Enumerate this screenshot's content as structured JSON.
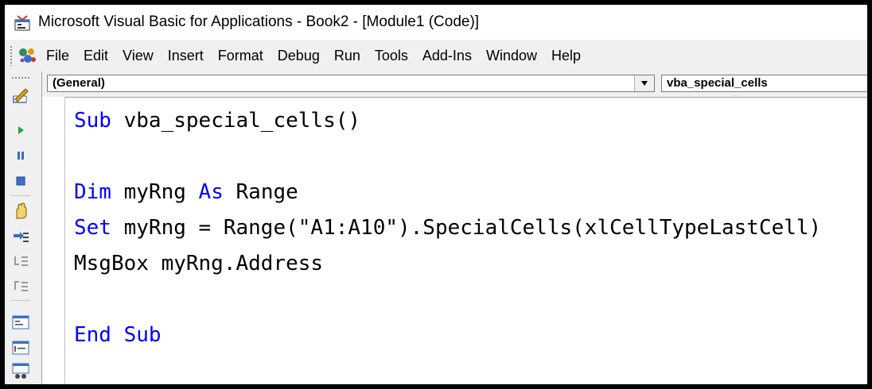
{
  "window": {
    "title": "Microsoft Visual Basic for Applications - Book2 - [Module1 (Code)]"
  },
  "menu": {
    "items": [
      "File",
      "Edit",
      "View",
      "Insert",
      "Format",
      "Debug",
      "Run",
      "Tools",
      "Add-Ins",
      "Window",
      "Help"
    ]
  },
  "toolbar": {
    "icons": [
      "design-mode-icon",
      "run-icon",
      "break-icon",
      "reset-icon",
      "toggle-breakpoint-icon",
      "step-into-icon",
      "step-over-icon",
      "step-out-icon",
      "locals-window-icon",
      "immediate-window-icon",
      "watch-window-icon"
    ]
  },
  "code_window": {
    "object_combo": "(General)",
    "procedure_combo": "vba_special_cells",
    "lines": [
      [
        {
          "t": "Sub",
          "kw": true
        },
        {
          "t": " vba_special_cells()",
          "kw": false
        }
      ],
      [],
      [
        {
          "t": "Dim",
          "kw": true
        },
        {
          "t": " myRng ",
          "kw": false
        },
        {
          "t": "As",
          "kw": true
        },
        {
          "t": " Range",
          "kw": false
        }
      ],
      [
        {
          "t": "Set",
          "kw": true
        },
        {
          "t": " myRng = Range(\"A1:A10\").SpecialCells(xlCellTypeLastCell)",
          "kw": false
        }
      ],
      [
        {
          "t": "MsgBox myRng.Address",
          "kw": false
        }
      ],
      [],
      [
        {
          "t": "End Sub",
          "kw": true
        }
      ]
    ]
  },
  "colors": {
    "keyword": "#0000ff",
    "text": "#000000"
  }
}
